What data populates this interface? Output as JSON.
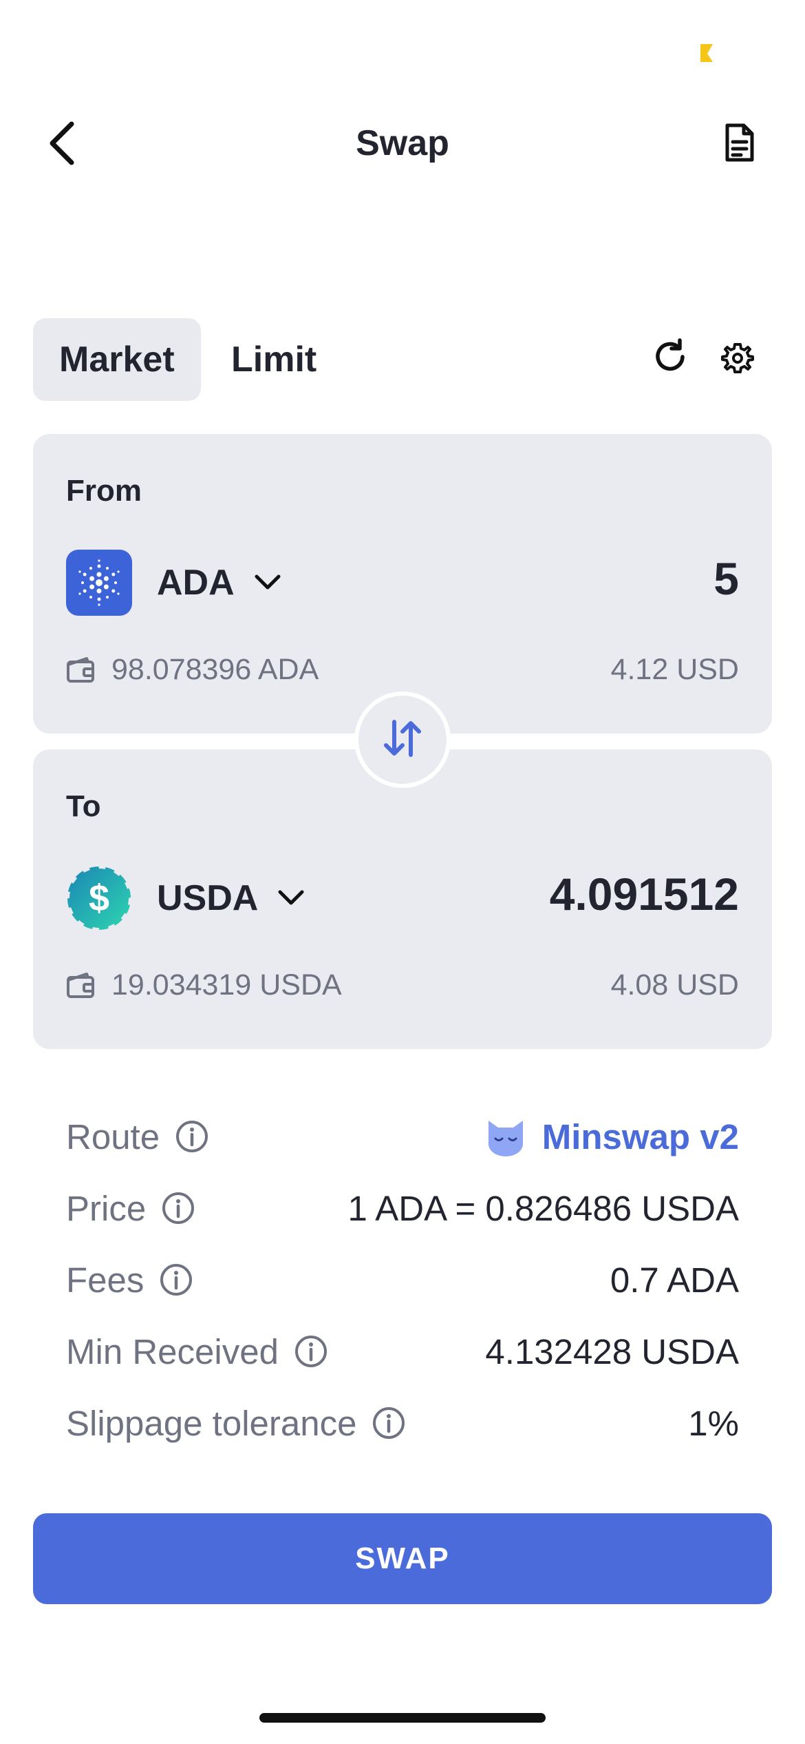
{
  "header": {
    "title": "Swap"
  },
  "tabs": [
    {
      "label": "Market",
      "active": true
    },
    {
      "label": "Limit",
      "active": false
    }
  ],
  "from": {
    "label": "From",
    "token": "ADA",
    "amount": "5",
    "balance": "98.078396 ADA",
    "usd": "4.12 USD",
    "logo_color": "#3d63d8"
  },
  "to": {
    "label": "To",
    "token": "USDA",
    "amount": "4.091512",
    "balance": "19.034319 USDA",
    "usd": "4.08 USD",
    "logo_color": "#1fb7a4"
  },
  "details": {
    "route": {
      "label": "Route",
      "value": "Minswap v2"
    },
    "price": {
      "label": "Price",
      "value": "1 ADA = 0.826486 USDA"
    },
    "fees": {
      "label": "Fees",
      "value": "0.7 ADA"
    },
    "min_received": {
      "label": "Min Received",
      "value": "4.132428 USDA"
    },
    "slippage": {
      "label": "Slippage tolerance",
      "value": "1%"
    }
  },
  "swap_button": {
    "label": "SWAP"
  },
  "colors": {
    "accent": "#4b6bdb",
    "card_bg": "#e9ebf0",
    "muted_text": "#6f7381",
    "status_indicator": "#f5c518"
  }
}
